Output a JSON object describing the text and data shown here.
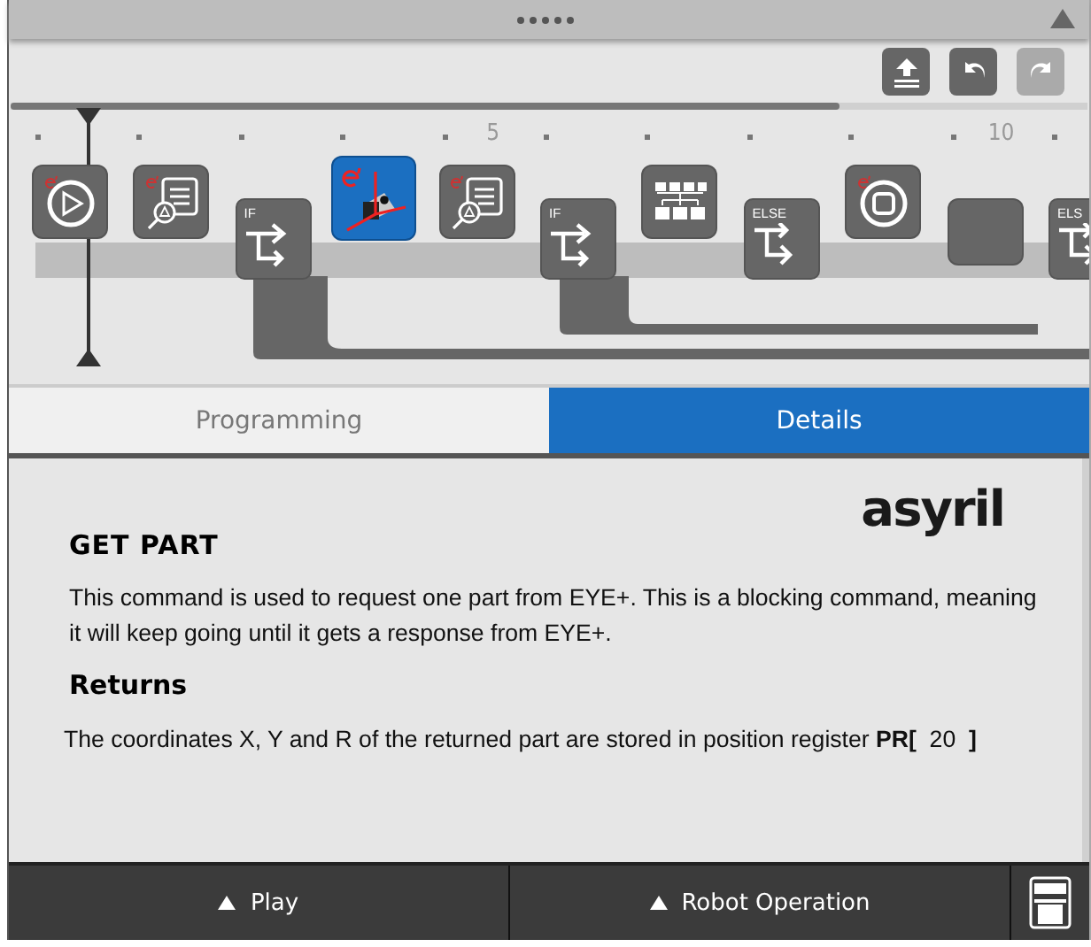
{
  "toolbar": {
    "buttons": [
      {
        "kind": "upload",
        "disabled": false
      },
      {
        "kind": "undo",
        "disabled": false
      },
      {
        "kind": "redo",
        "disabled": true
      }
    ]
  },
  "ruler": {
    "marks": [
      {
        "kind": "tick"
      },
      {
        "kind": "tick"
      },
      {
        "kind": "tick"
      },
      {
        "kind": "tick"
      },
      {
        "kind": "tick"
      },
      {
        "kind": "label",
        "text": "5"
      },
      {
        "kind": "tick"
      },
      {
        "kind": "tick"
      },
      {
        "kind": "tick"
      },
      {
        "kind": "tick"
      },
      {
        "kind": "tick"
      },
      {
        "kind": "label",
        "text": "10"
      },
      {
        "kind": "tick"
      }
    ]
  },
  "program": {
    "nodes": [
      {
        "kind": "start",
        "selected": false
      },
      {
        "kind": "inspect",
        "selected": false
      },
      {
        "kind": "if",
        "label": "IF",
        "selected": false
      },
      {
        "kind": "vision",
        "selected": true
      },
      {
        "kind": "inspect",
        "selected": false
      },
      {
        "kind": "if",
        "label": "IF",
        "selected": false
      },
      {
        "kind": "parallel",
        "selected": false
      },
      {
        "kind": "else",
        "label": "ELSE",
        "selected": false
      },
      {
        "kind": "stop",
        "selected": false
      },
      {
        "kind": "end",
        "selected": false
      },
      {
        "kind": "else",
        "label": "ELS",
        "selected": false
      }
    ]
  },
  "tabs": [
    {
      "label": "Programming",
      "selected": false
    },
    {
      "label": "Details",
      "selected": true
    }
  ],
  "details": {
    "logo": "asyril",
    "title": "GET PART",
    "description": "This command is used to request one part from EYE+. This is a blocking command, meaning it will keep going until it gets a response from EYE+.",
    "returns_heading": "Returns",
    "returns_text": "The coordinates X, Y and R of the returned part are stored in position register **PR[**  20  **]**"
  },
  "bottom_bar": {
    "buttons": [
      {
        "label": "Play"
      },
      {
        "label": "Robot Operation"
      }
    ]
  }
}
